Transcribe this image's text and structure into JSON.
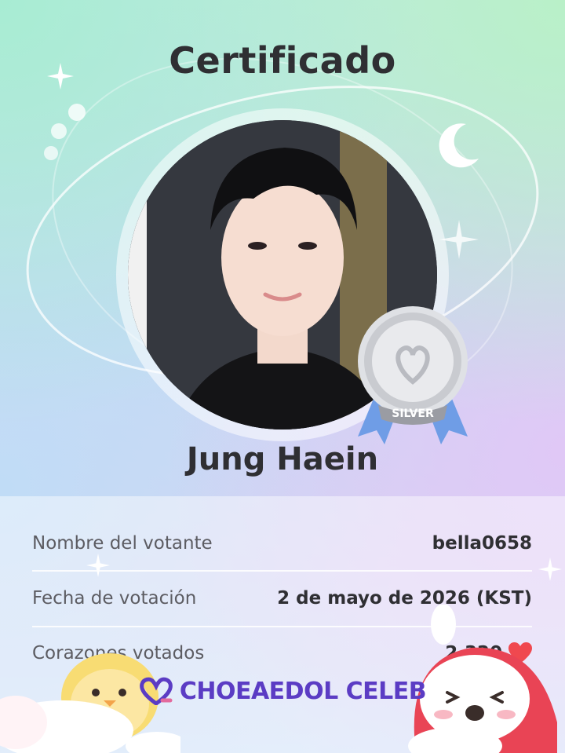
{
  "certificate": {
    "title": "Certificado",
    "celebrity_name": "Jung Haein",
    "badge": {
      "tier_label": "SILVER",
      "icon": "silver-medal-icon"
    }
  },
  "details": [
    {
      "label": "Nombre del votante",
      "value": "bella0658"
    },
    {
      "label": "Fecha de votación",
      "value": "2 de mayo de 2026 (KST)"
    },
    {
      "label": "Corazones votados",
      "value": "2,320",
      "icon": "heart-icon"
    }
  ],
  "brand": {
    "name": "CHOEAEDOL CELEB",
    "logo_icon": "heart-logo-icon"
  },
  "colors": {
    "title": "#2f2f33",
    "label": "#5c5c62",
    "brand": "#5b3cc4",
    "heart": "#f0484f",
    "silver": "#c9cbd0",
    "ribbon": "#6f9de6"
  }
}
